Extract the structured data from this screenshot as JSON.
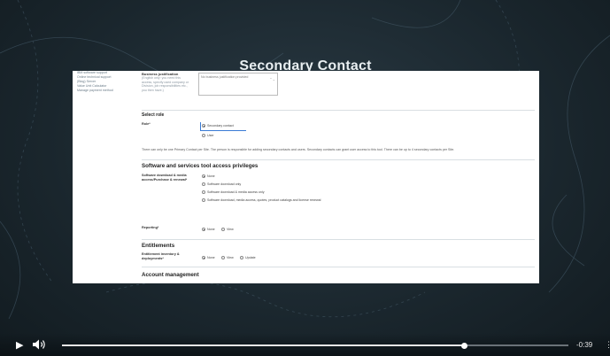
{
  "video": {
    "title": "Secondary Contact",
    "time_remaining": "-0:39",
    "progress": 0.795,
    "controls": {
      "play_icon": "▶",
      "more_icon": "⋮"
    }
  },
  "left_nav": {
    "items": [
      "IBM software support",
      "Online technical support",
      "(Blog) Server",
      "Value Unit Calculator",
      "Manage payment method"
    ]
  },
  "business_justification": {
    "label": "Business justification",
    "help": "(English only: you need this access, specify used company or Division, job responsibilities etc., you then have.)",
    "value": "No business justification provided",
    "scroll_icon": "⌃⌄"
  },
  "select_role": {
    "heading": "Select role",
    "label": "Role*",
    "options": [
      {
        "label": "Secondary contact",
        "selected": true
      },
      {
        "label": "User",
        "selected": false
      }
    ],
    "note": "There can only be one Primary Contact per Site. The person is responsible for adding secondary contacts and users. Secondary contacts can grant user access to this tool. There can be up to 4 secondary contacts per Site."
  },
  "software_services": {
    "heading": "Software and services tool access privileges",
    "download_label": "Software download & media access/Purchase & renewal*",
    "download_options": [
      {
        "label": "None",
        "selected": true
      },
      {
        "label": "Software download only",
        "selected": false
      },
      {
        "label": "Software download & media access only",
        "selected": false
      },
      {
        "label": "Software download, media access, quotes, product catalogs and license renewal",
        "selected": false
      }
    ],
    "reporting_label": "Reporting*",
    "reporting_options": [
      {
        "label": "None",
        "selected": true
      },
      {
        "label": "View",
        "selected": false
      }
    ]
  },
  "entitlements": {
    "heading": "Entitlements",
    "label": "Entitlement inventory & deployments*",
    "options": [
      {
        "label": "None",
        "selected": true
      },
      {
        "label": "View",
        "selected": false
      },
      {
        "label": "Update",
        "selected": false
      }
    ]
  },
  "account_management": {
    "heading": "Account management"
  }
}
